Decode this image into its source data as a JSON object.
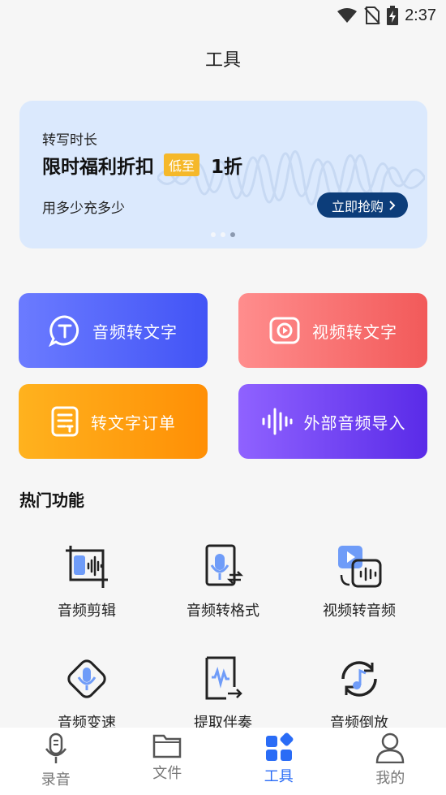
{
  "status_bar": {
    "time": "2:37"
  },
  "page": {
    "title": "工具"
  },
  "banner": {
    "subtitle": "转写时长",
    "title": "限时福利折扣",
    "badge": "低至",
    "deal": "1折",
    "description": "用多少充多少",
    "button_label": "立即抢购",
    "page_dots": 3,
    "active_dot": 3
  },
  "main_tools": [
    {
      "label": "音频转文字",
      "icon": "speech-bubble-t-icon"
    },
    {
      "label": "视频转文字",
      "icon": "video-play-icon"
    },
    {
      "label": "转文字订单",
      "icon": "document-list-icon"
    },
    {
      "label": "外部音频导入",
      "icon": "audio-waveform-icon"
    }
  ],
  "hot_features": {
    "title": "热门功能",
    "items": [
      {
        "label": "音频剪辑",
        "icon": "audio-crop-icon"
      },
      {
        "label": "音频转格式",
        "icon": "audio-format-convert-icon"
      },
      {
        "label": "视频转音频",
        "icon": "video-to-audio-icon"
      },
      {
        "label": "音频变速",
        "icon": "audio-speed-icon"
      },
      {
        "label": "提取伴奏",
        "icon": "extract-accompaniment-icon"
      },
      {
        "label": "音频倒放",
        "icon": "audio-reverse-icon"
      }
    ]
  },
  "bottom_nav": {
    "items": [
      {
        "label": "录音",
        "icon": "microphone-icon"
      },
      {
        "label": "文件",
        "icon": "folder-icon"
      },
      {
        "label": "工具",
        "icon": "tools-grid-icon"
      },
      {
        "label": "我的",
        "icon": "person-icon"
      }
    ],
    "active": "工具"
  },
  "colors": {
    "accent": "#2a6cf6",
    "banner_bg": "#dbe9fd",
    "banner_button": "#0c3d7a",
    "badge": "#f5b82a",
    "card_audio": "#4f62fb",
    "card_video": "#f56a6a",
    "card_orders": "#ff9a10",
    "card_import": "#7445f5"
  }
}
